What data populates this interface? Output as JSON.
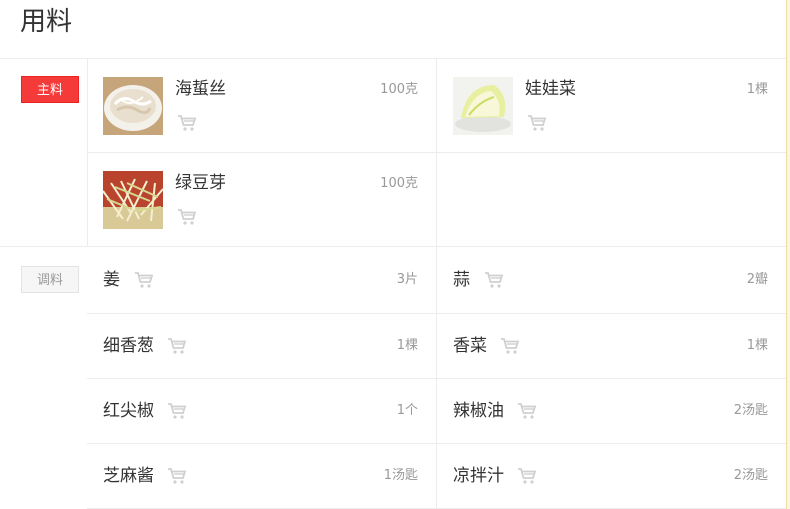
{
  "title": "用料",
  "main_label": "主料",
  "sub_label": "调料",
  "main_ingredients": [
    {
      "name": "海蜇丝",
      "qty": "100克",
      "image": "jellyfish-shreds-photo"
    },
    {
      "name": "娃娃菜",
      "qty": "1棵",
      "image": "baby-cabbage-photo"
    },
    {
      "name": "绿豆芽",
      "qty": "100克",
      "image": "mung-bean-sprouts-photo"
    }
  ],
  "seasonings": [
    {
      "name": "姜",
      "qty": "3片"
    },
    {
      "name": "蒜",
      "qty": "2瓣"
    },
    {
      "name": "细香葱",
      "qty": "1棵"
    },
    {
      "name": "香菜",
      "qty": "1棵"
    },
    {
      "name": "红尖椒",
      "qty": "1个"
    },
    {
      "name": "辣椒油",
      "qty": "2汤匙"
    },
    {
      "name": "芝麻酱",
      "qty": "1汤匙"
    },
    {
      "name": "凉拌汁",
      "qty": "2汤匙"
    }
  ],
  "icons": {
    "cart": "shopping-cart-icon"
  },
  "colors": {
    "accent": "#f53a3a",
    "muted_text": "#999999",
    "cart": "#d0d0d0"
  }
}
